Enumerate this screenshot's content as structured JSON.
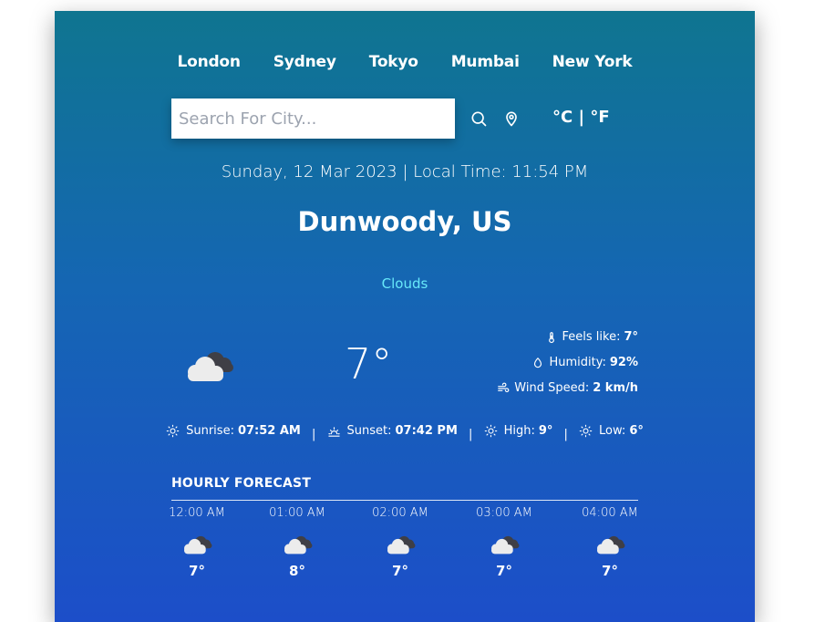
{
  "cities": [
    "London",
    "Sydney",
    "Tokyo",
    "Mumbai",
    "New York"
  ],
  "search": {
    "placeholder": "Search For City..."
  },
  "units": {
    "celsius": "°C",
    "separator": "|",
    "fahrenheit": "°F"
  },
  "datetime": "Sunday, 12 Mar 2023 | Local Time: 11:54 PM",
  "location": "Dunwoody, US",
  "condition": "Clouds",
  "current": {
    "temperature": "7°",
    "icon": "cloud-icon",
    "feels_like_label": "Feels like:",
    "feels_like": "7°",
    "humidity_label": "Humidity:",
    "humidity": "92%",
    "wind_label": "Wind Speed:",
    "wind": "2 km/h"
  },
  "sun": {
    "sunrise_label": "Sunrise:",
    "sunrise": "07:52 AM",
    "sunset_label": "Sunset:",
    "sunset": "07:42 PM",
    "high_label": "High:",
    "high": "9°",
    "low_label": "Low:",
    "low": "6°",
    "separator": "|"
  },
  "hourly": {
    "title": "HOURLY FORECAST",
    "items": [
      {
        "time": "12:00 AM",
        "temp": "7°",
        "icon": "cloud-icon"
      },
      {
        "time": "01:00 AM",
        "temp": "8°",
        "icon": "cloud-icon"
      },
      {
        "time": "02:00 AM",
        "temp": "7°",
        "icon": "cloud-icon"
      },
      {
        "time": "03:00 AM",
        "temp": "7°",
        "icon": "cloud-icon"
      },
      {
        "time": "04:00 AM",
        "temp": "7°",
        "icon": "cloud-icon"
      }
    ]
  },
  "colors": {
    "gradient_top": "#0f7590",
    "gradient_bottom": "#1c4ec9",
    "condition": "#67e8f9"
  }
}
